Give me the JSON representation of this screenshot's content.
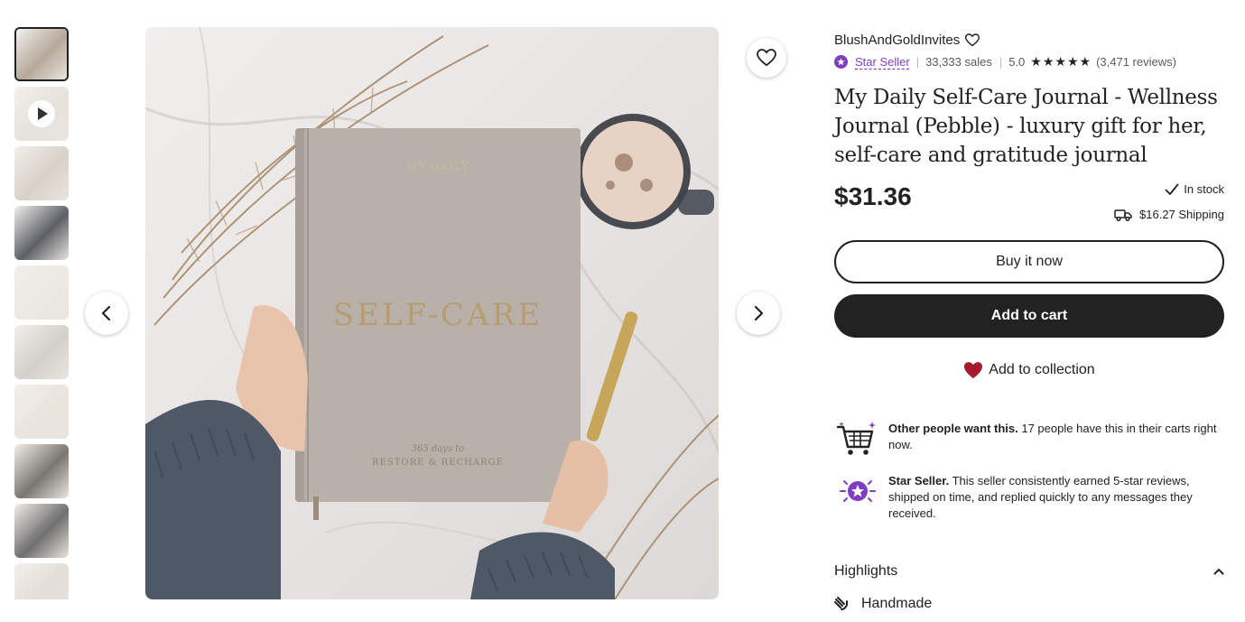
{
  "gallery": {
    "thumbnail_count": 10,
    "thumbnail_colors": [
      "#b5a99a",
      "#e6e2dd",
      "#d8d1c8",
      "#5d6066",
      "#ece8e2",
      "#d3d0cc",
      "#e9e4dc",
      "#7a7670",
      "#6f6f6f",
      "#e3ddd6"
    ],
    "video_thumbnail_index": 1,
    "active_index": 0,
    "main_image": {
      "cover_top": "MY DAILY",
      "cover_title": "SELF-CARE",
      "cover_sub1": "365 days to",
      "cover_sub2": "RESTORE & RECHARGE"
    }
  },
  "shop": {
    "name": "BlushAndGoldInvites",
    "badge": "Star Seller",
    "sales": "33,333 sales",
    "rating": "5.0",
    "stars": "★★★★★",
    "reviews": "(3,471 reviews)"
  },
  "listing": {
    "title": "My Daily Self-Care Journal - Wellness Journal (Pebble) - luxury gift for her, self-care and gratitude journal",
    "price": "$31.36",
    "stock": "In stock",
    "shipping": "$16.27 Shipping"
  },
  "actions": {
    "buy_now": "Buy it now",
    "add_to_cart": "Add to cart",
    "add_to_collection": "Add to collection"
  },
  "info": {
    "demand_bold": "Other people want this.",
    "demand_text": " 17 people have this in their carts right now.",
    "seller_bold": "Star Seller.",
    "seller_text": " This seller consistently earned 5-star reviews, shipped on time, and replied quickly to any messages they received."
  },
  "highlights": {
    "heading": "Highlights",
    "items": [
      "Handmade"
    ]
  },
  "colors": {
    "accent_purple": "#7e3ebf",
    "heart_red": "#a61a2e",
    "button_dark": "#222222"
  },
  "icons": [
    "heart-outline-icon",
    "star-seller-badge-icon",
    "check-icon",
    "truck-icon",
    "chevron-left-icon",
    "chevron-right-icon",
    "cart-icon",
    "chevron-up-icon",
    "hand-icon",
    "play-icon"
  ]
}
